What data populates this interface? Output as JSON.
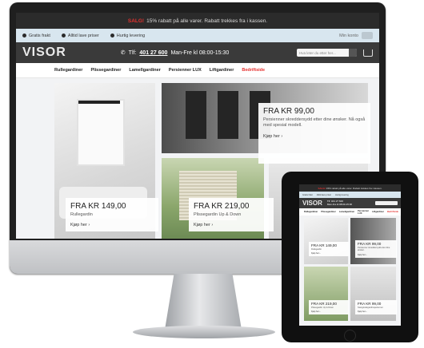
{
  "desktop": {
    "salebar": {
      "sale": "SALG!",
      "text": "15% rabatt på alle varer. Rabatt trekkes fra i kassen."
    },
    "usps": [
      "Gratis frakt",
      "Alltid lave priser",
      "Hurtig levering"
    ],
    "account_label": "Min konto",
    "logo": "VISOR",
    "phone_prefix": "Tlf:",
    "phone_number": "401 27 600",
    "hours": "Man-Fre kl 08:00-15:30",
    "search_placeholder": "Hva leter du etter her...",
    "nav": [
      "Rullegardiner",
      "Plissegardiner",
      "Lamellgardiner",
      "Persienner LUX",
      "Liftgardiner",
      "Bedriftside"
    ],
    "tiles": [
      {
        "price": "FRA KR 149,00",
        "desc": "Rullegardin",
        "buy": "Kjøp her ›"
      },
      {
        "price": "FRA KR 99,00",
        "desc": "Persienner skreddersydd etter dine ønsker. Nå også med spesial modell.",
        "buy": "Kjøp her ›"
      },
      {
        "price": "FRA KR 219,00",
        "desc": "Plissegardin Up & Down",
        "buy": "Kjøp her ›"
      }
    ]
  },
  "tablet": {
    "salebar": {
      "sale": "SALG!",
      "text": "15% rabatt på alle varer. Rabatt trekkes fra i kassen."
    },
    "usps": [
      "Gratis frakt",
      "Alltid lave priser",
      "Hurtig levering"
    ],
    "logo": "VISOR",
    "phone": "Tlf: 401 27 600",
    "hours": "Man-Fre kl 08:00-15:30",
    "nav": [
      "Rullegardiner",
      "Plissegardiner",
      "Lamellgardiner",
      "Persienner LUX",
      "Liftgardiner",
      "Bedriftside"
    ],
    "tiles": [
      {
        "price": "FRA KR 149,00",
        "desc": "Rullegardin",
        "buy": "Kjøp her ›"
      },
      {
        "price": "FRA KR 99,00",
        "desc": "Persienner skreddersydd etter dine ønsker.",
        "buy": "Kjøp her ›"
      },
      {
        "price": "FRA KR 219,00",
        "desc": "Plissegardin Up & Down",
        "buy": "Kjøp her ›"
      },
      {
        "price": "FRA KR 99,00",
        "desc": "Stangtrekkgardinsperienner",
        "buy": "Kjøp her ›"
      }
    ]
  }
}
